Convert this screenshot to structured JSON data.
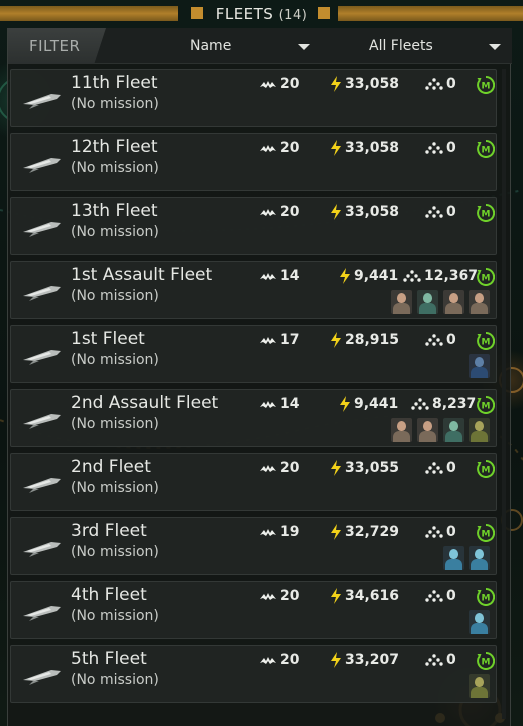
{
  "header": {
    "title": "FLEETS",
    "count": "(14)"
  },
  "filterbar": {
    "filter_label": "FILTER",
    "sort_value": "Name",
    "scope_value": "All Fleets"
  },
  "colors": {
    "accent_gold": "#c38d2e",
    "power_yellow": "#f3d21a",
    "mission_green": "#6fd12a"
  },
  "fleets": [
    {
      "name": "11th Fleet",
      "mission": "(No mission)",
      "ships": "20",
      "power": "33,058",
      "manpower": "0",
      "heroes": []
    },
    {
      "name": "12th Fleet",
      "mission": "(No mission)",
      "ships": "20",
      "power": "33,058",
      "manpower": "0",
      "heroes": []
    },
    {
      "name": "13th Fleet",
      "mission": "(No mission)",
      "ships": "20",
      "power": "33,058",
      "manpower": "0",
      "heroes": []
    },
    {
      "name": "1st Assault Fleet",
      "mission": "(No mission)",
      "ships": "14",
      "power": "9,441",
      "manpower": "12,367",
      "heroes": [
        "bald-portrait",
        "alien-portrait",
        "bald-portrait",
        "bald-portrait"
      ]
    },
    {
      "name": "1st Fleet",
      "mission": "(No mission)",
      "ships": "17",
      "power": "28,915",
      "manpower": "0",
      "heroes": [
        "hooded-portrait"
      ]
    },
    {
      "name": "2nd Assault Fleet",
      "mission": "(No mission)",
      "ships": "14",
      "power": "9,441",
      "manpower": "8,237",
      "heroes": [
        "bald-portrait",
        "bald-portrait",
        "alien-portrait",
        "insect-portrait"
      ]
    },
    {
      "name": "2nd Fleet",
      "mission": "(No mission)",
      "ships": "20",
      "power": "33,055",
      "manpower": "0",
      "heroes": []
    },
    {
      "name": "3rd Fleet",
      "mission": "(No mission)",
      "ships": "19",
      "power": "32,729",
      "manpower": "0",
      "heroes": [
        "cyan-portrait",
        "cyan-portrait"
      ]
    },
    {
      "name": "4th Fleet",
      "mission": "(No mission)",
      "ships": "20",
      "power": "34,616",
      "manpower": "0",
      "heroes": [
        "cyan-portrait"
      ]
    },
    {
      "name": "5th Fleet",
      "mission": "(No mission)",
      "ships": "20",
      "power": "33,207",
      "manpower": "0",
      "heroes": [
        "insect-portrait"
      ]
    }
  ]
}
